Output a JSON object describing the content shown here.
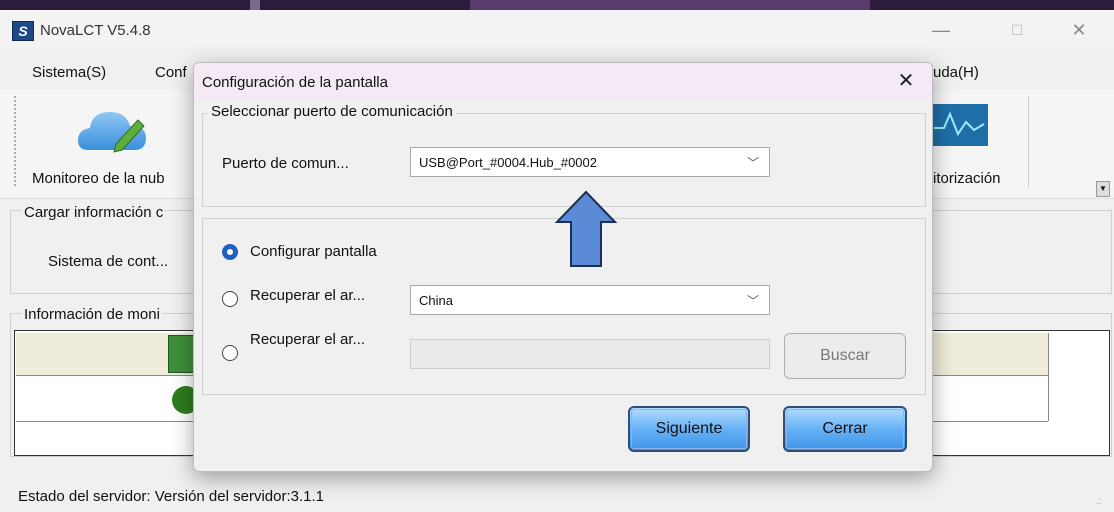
{
  "window": {
    "title": "NovaLCT V5.4.8",
    "minimize": "—",
    "maximize": "☐",
    "close": "✕"
  },
  "menu": {
    "items": [
      "Sistema(S)",
      "Conf",
      "uda(H)"
    ]
  },
  "toolbar": {
    "cloud_label": "Monitoreo de la nub",
    "monitor_label": "itorización"
  },
  "main": {
    "load_info_legend": "Cargar información c",
    "control_system_label": "Sistema de cont...",
    "monitor_info_legend": "Información de moni"
  },
  "status_bar": {
    "text": "Estado del servidor:  Versión del servidor:3.1.1"
  },
  "dialog": {
    "title": "Configuración de la pantalla",
    "close": "✕",
    "port_section_legend": "Seleccionar puerto de comunicación",
    "port_label": "Puerto de comun...",
    "port_value": "USB@Port_#0004.Hub_#0002",
    "options": [
      {
        "label": "Configurar pantalla",
        "selected": true
      },
      {
        "label": "Recuperar el ar...",
        "selected": false
      },
      {
        "label": "Recuperar el ar...",
        "selected": false
      }
    ],
    "region_value": "China",
    "buscar_label": "Buscar",
    "next_label": "Siguiente",
    "close_label": "Cerrar"
  },
  "colors": {
    "accent_arrow": "#5b8ad6",
    "button_blue": "#3f94e8",
    "dialog_title_bg": "#f4e9f4"
  },
  "icons": [
    "app-logo-icon",
    "cloud-edit-icon",
    "monitor-wave-icon",
    "chevron-down-icon",
    "up-arrow-icon"
  ]
}
